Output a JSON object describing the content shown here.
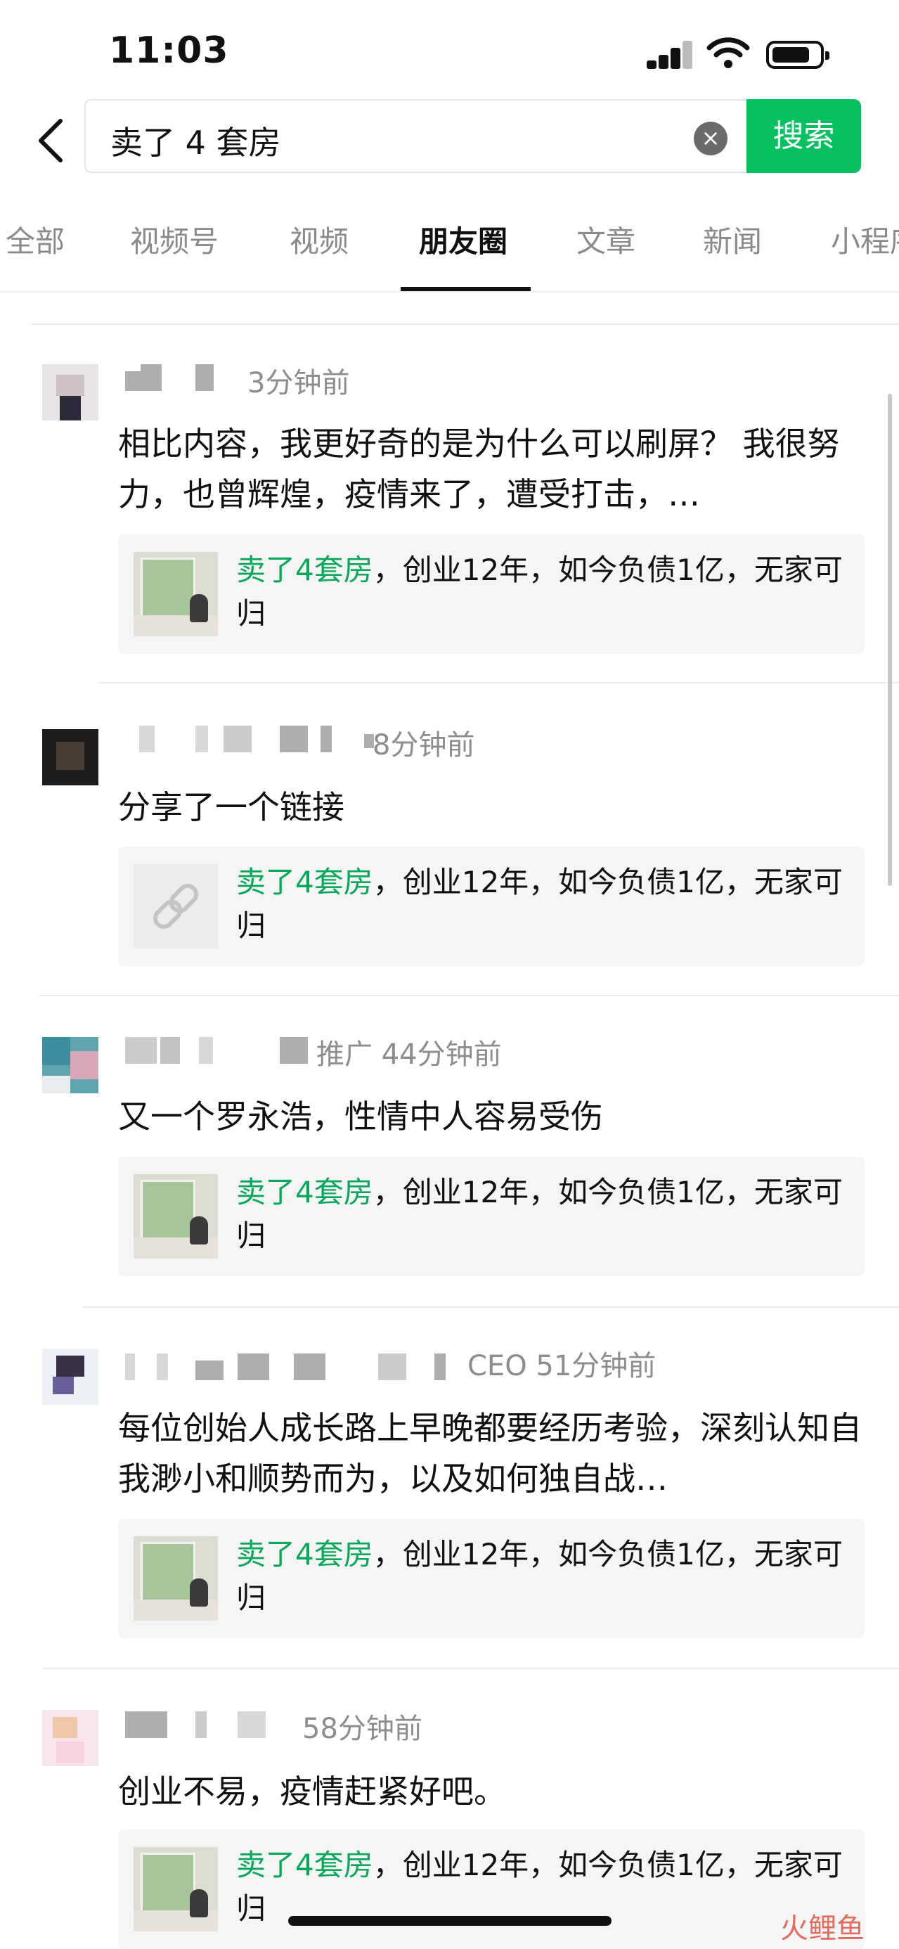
{
  "status_bar": {
    "time": "11:03"
  },
  "search": {
    "query": "卖了 4 套房",
    "clear_icon": "×",
    "button_label": "搜索"
  },
  "tabs": [
    {
      "label": "全部"
    },
    {
      "label": "视频号"
    },
    {
      "label": "视频"
    },
    {
      "label": "朋友圈",
      "active": true
    },
    {
      "label": "文章"
    },
    {
      "label": "新闻"
    },
    {
      "label": "小程序"
    }
  ],
  "card_highlight": "卖了4套房",
  "card_rest": "，创业12年，如今负债1亿，无家可归",
  "posts": [
    {
      "meta": "3分钟前",
      "text": "相比内容，我更好奇的是为什么可以刷屏？ 我很努力，也曾辉煌，疫情来了，遭受打击，…",
      "card_type": "image"
    },
    {
      "meta": "8分钟前",
      "text": "分享了一个链接",
      "card_type": "link"
    },
    {
      "meta": "推广  44分钟前",
      "text": "又一个罗永浩，性情中人容易受伤",
      "card_type": "image"
    },
    {
      "meta": "CEO  51分钟前",
      "text": "每位创始人成长路上早晚都要经历考验，深刻认知自我渺小和顺势而为，以及如何独自战…",
      "card_type": "image"
    },
    {
      "meta": "58分钟前",
      "text": "创业不易，疫情赶紧好吧。",
      "card_type": "image"
    }
  ],
  "watermark": "火鲤鱼",
  "icons": {
    "back": "chevron-left-icon",
    "signal": "signal-icon",
    "wifi": "wifi-icon",
    "battery": "battery-icon",
    "link": "link-icon"
  },
  "colors": {
    "accent": "#07c160",
    "highlight": "#07a85a"
  }
}
